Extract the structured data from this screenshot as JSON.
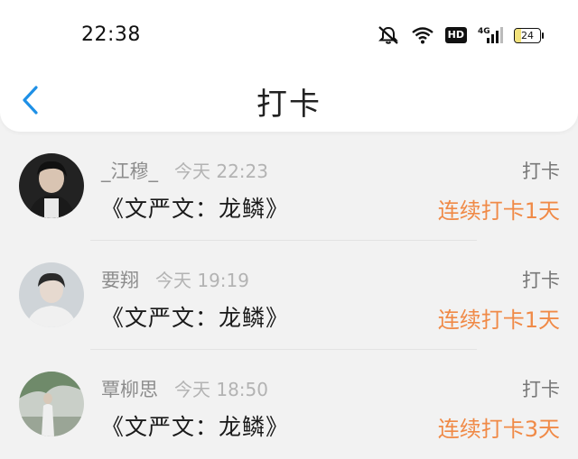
{
  "status_bar": {
    "time": "22:38",
    "hd": "HD",
    "network": "4G",
    "battery": "24",
    "battery_level": 0.24,
    "icons": [
      "mute-icon",
      "wifi-icon",
      "hd-icon",
      "signal-4g-icon",
      "battery-icon"
    ]
  },
  "header": {
    "title": "打卡",
    "back_icon": "chevron-left-icon"
  },
  "colors": {
    "accent": "#1e90e6",
    "streak": "#f08a47",
    "background": "#f2f2f2"
  },
  "checkins": [
    {
      "user": "_江穆_",
      "time": "今天 22:23",
      "book": "《文严文：龙鳞》",
      "action": "打卡",
      "streak": "连续打卡1天"
    },
    {
      "user": "要翔",
      "time": "今天 19:19",
      "book": "《文严文：龙鳞》",
      "action": "打卡",
      "streak": "连续打卡1天"
    },
    {
      "user": "覃柳思",
      "time": "今天 18:50",
      "book": "《文严文：龙鳞》",
      "action": "打卡",
      "streak": "连续打卡3天"
    }
  ]
}
